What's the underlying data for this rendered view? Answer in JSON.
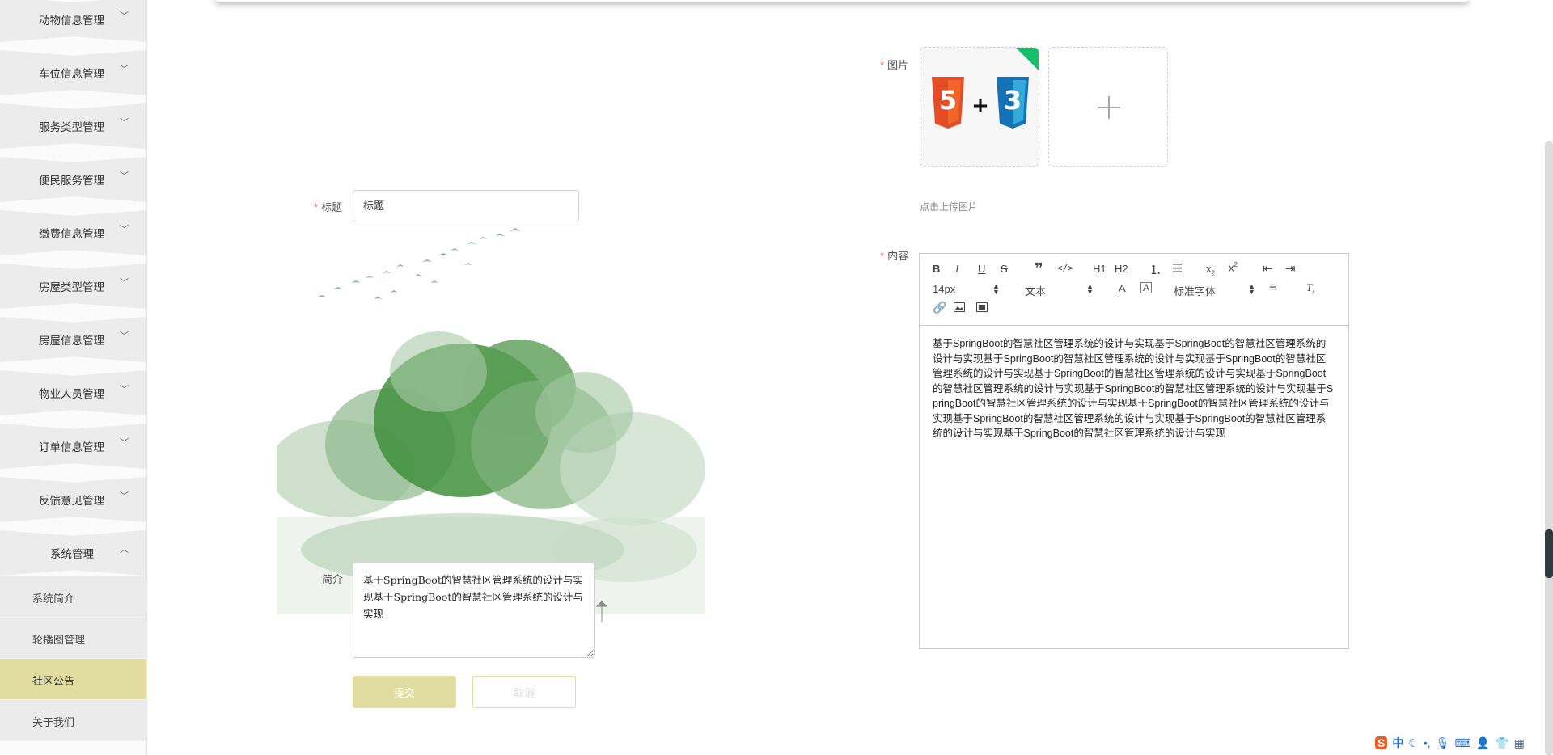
{
  "sidebar": {
    "items": [
      {
        "label": "动物信息管理"
      },
      {
        "label": "车位信息管理"
      },
      {
        "label": "服务类型管理"
      },
      {
        "label": "便民服务管理"
      },
      {
        "label": "缴费信息管理"
      },
      {
        "label": "房屋类型管理"
      },
      {
        "label": "房屋信息管理"
      },
      {
        "label": "物业人员管理"
      },
      {
        "label": "订单信息管理"
      },
      {
        "label": "反馈意见管理"
      },
      {
        "label": "系统管理"
      }
    ],
    "submenu": [
      {
        "label": "系统简介"
      },
      {
        "label": "轮播图管理"
      },
      {
        "label": "社区公告"
      },
      {
        "label": "关于我们"
      }
    ],
    "active": "社区公告"
  },
  "form": {
    "required_mark": "*",
    "title_label": "标题",
    "title_value": "标题",
    "summary_label": "简介",
    "summary_value": "基于SpringBoot的智慧社区管理系统的设计与实现基于SpringBoot的智慧社区管理系统的设计与实现",
    "image_label": "图片",
    "upload_hint": "点击上传图片",
    "content_label": "内容",
    "submit_label": "提交",
    "cancel_label": "取消"
  },
  "editor": {
    "font_size": "14px",
    "block_type": "文本",
    "font_family": "标准字体",
    "h1": "H1",
    "h2": "H2",
    "content": "基于SpringBoot的智慧社区管理系统的设计与实现基于SpringBoot的智慧社区管理系统的设计与实现基于SpringBoot的智慧社区管理系统的设计与实现基于SpringBoot的智慧社区管理系统的设计与实现基于SpringBoot的智慧社区管理系统的设计与实现基于SpringBoot的智慧社区管理系统的设计与实现基于SpringBoot的智慧社区管理系统的设计与实现基于SpringBoot的智慧社区管理系统的设计与实现基于SpringBoot的智慧社区管理系统的设计与实现基于SpringBoot的智慧社区管理系统的设计与实现基于SpringBoot的智慧社区管理系统的设计与实现基于SpringBoot的智慧社区管理系统的设计与实现"
  },
  "tray": {
    "ime_label": "中",
    "icons": [
      "sogou-logo-icon",
      "moon-icon",
      "punctuation-icon",
      "microphone-icon",
      "keyboard-icon",
      "user-icon",
      "shirt-icon",
      "grid-icon"
    ]
  },
  "colors": {
    "accent": "#e1dca0",
    "required": "#f56c6c",
    "sidebar_bg": "#ececec"
  }
}
